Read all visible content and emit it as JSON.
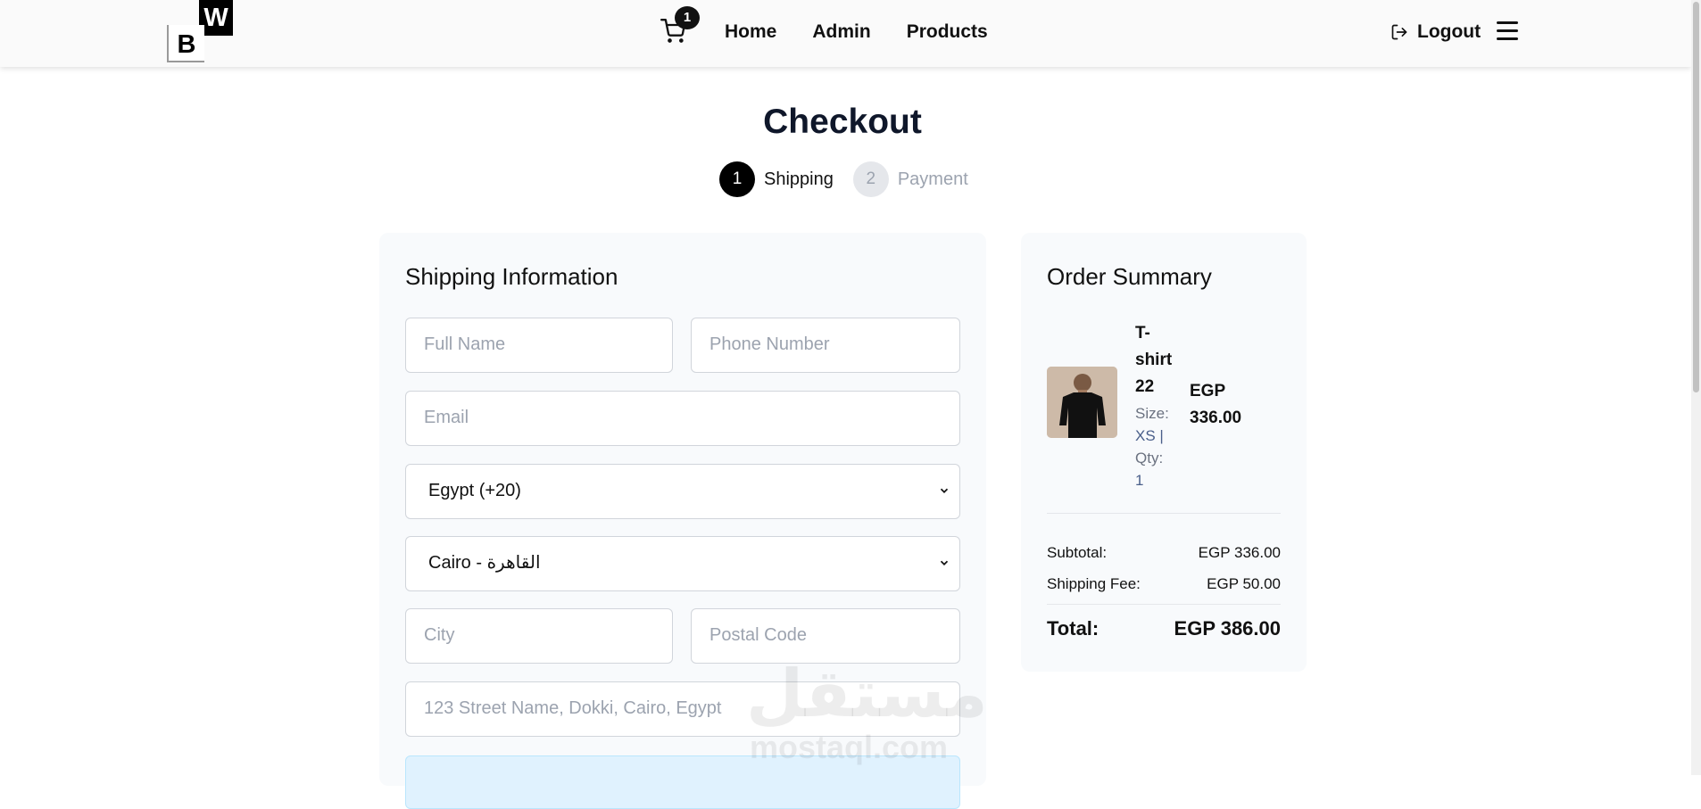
{
  "header": {
    "logo": {
      "letter_top": "W",
      "letter_bottom": "B"
    },
    "cart": {
      "count": "1",
      "icon": "cart-icon"
    },
    "nav": [
      {
        "label": "Home"
      },
      {
        "label": "Admin"
      },
      {
        "label": "Products"
      }
    ],
    "logout": {
      "label": "Logout",
      "icon": "logout-icon"
    },
    "menu_icon": "hamburger-menu-icon"
  },
  "page": {
    "title": "Checkout",
    "steps": [
      {
        "number": "1",
        "label": "Shipping",
        "active": true
      },
      {
        "number": "2",
        "label": "Payment",
        "active": false
      }
    ]
  },
  "shipping": {
    "title": "Shipping Information",
    "full_name_placeholder": "Full Name",
    "phone_placeholder": "Phone Number",
    "email_placeholder": "Email",
    "country_selected": "Egypt (+20)",
    "governorate_selected": "Cairo - القاهرة",
    "city_placeholder": "City",
    "postal_placeholder": "Postal Code",
    "address_placeholder": "123 Street Name, Dokki, Cairo, Egypt"
  },
  "summary": {
    "title": "Order Summary",
    "item": {
      "name": "T-shirt 22",
      "size_label": "Size:",
      "size_value": "XS",
      "qty_label": "Qty:",
      "qty_value": "1",
      "price": "EGP 336.00"
    },
    "subtotal_label": "Subtotal:",
    "subtotal_value": "EGP 336.00",
    "shipping_label": "Shipping Fee:",
    "shipping_value": "EGP 50.00",
    "total_label": "Total:",
    "total_value": "EGP 386.00"
  },
  "watermark": {
    "arabic": "مستقل",
    "latin": "mostaql.com"
  }
}
